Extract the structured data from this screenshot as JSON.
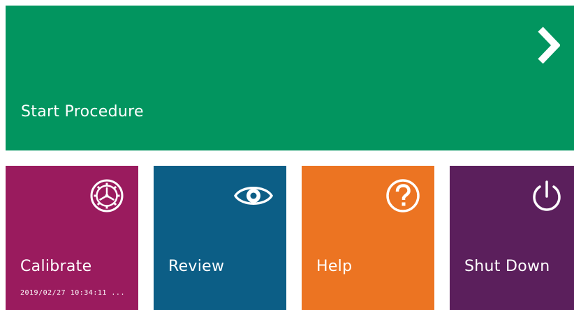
{
  "colors": {
    "start": "#02955f",
    "calibrate": "#9a1b5e",
    "review": "#0c5e86",
    "help": "#ec7422",
    "shutdown": "#5b1f5c"
  },
  "start": {
    "label": "Start Procedure",
    "icon": "chevron-right-icon"
  },
  "tiles": [
    {
      "label": "Calibrate",
      "icon": "calibrate-gear-icon",
      "subtext": "2019/02/27 10:34:11 ..."
    },
    {
      "label": "Review",
      "icon": "eye-icon"
    },
    {
      "label": "Help",
      "icon": "question-mark-icon"
    },
    {
      "label": "Shut Down",
      "icon": "power-icon"
    }
  ]
}
